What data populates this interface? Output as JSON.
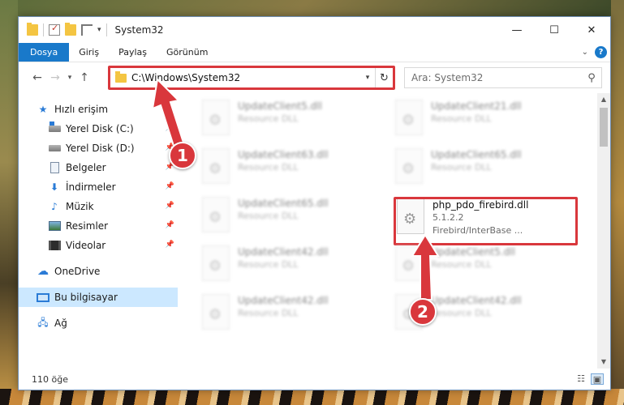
{
  "window": {
    "title": "System32",
    "controls": {
      "minimize": "—",
      "maximize": "☐",
      "close": "✕"
    }
  },
  "ribbon": {
    "tabs": [
      "Dosya",
      "Giriş",
      "Paylaş",
      "Görünüm"
    ],
    "help": "?"
  },
  "navigation": {
    "address": "C:\\Windows\\System32",
    "search_placeholder": "Ara: System32"
  },
  "sidebar": {
    "quick_access": "Hızlı erişim",
    "items": [
      {
        "label": "Yerel Disk (C:)",
        "icon": "disk-c-icon",
        "pinned": true
      },
      {
        "label": "Yerel Disk (D:)",
        "icon": "disk-d-icon",
        "pinned": true
      },
      {
        "label": "Belgeler",
        "icon": "documents-icon",
        "pinned": true
      },
      {
        "label": "İndirmeler",
        "icon": "downloads-icon",
        "pinned": true
      },
      {
        "label": "Müzik",
        "icon": "music-icon",
        "pinned": true
      },
      {
        "label": "Resimler",
        "icon": "pictures-icon",
        "pinned": true
      },
      {
        "label": "Videolar",
        "icon": "videos-icon",
        "pinned": true
      }
    ],
    "onedrive": "OneDrive",
    "this_pc": "Bu bilgisayar",
    "network": "Ağ"
  },
  "files": [
    {
      "name": "UpdateClient5.dll",
      "sub": "Resource DLL"
    },
    {
      "name": "UpdateClient21.dll",
      "sub": "Resource DLL"
    },
    {
      "name": "UpdateClient63.dll",
      "sub": "Resource DLL"
    },
    {
      "name": "UpdateClient65.dll",
      "sub": "Resource DLL"
    },
    {
      "name": "UpdateClient65.dll",
      "sub": "Resource DLL"
    },
    {
      "name": "php_pdo_firebird.dll",
      "version": "5.1.2.2",
      "sub": "Firebird/InterBase ..."
    },
    {
      "name": "UpdateClient42.dll",
      "sub": "Resource DLL"
    },
    {
      "name": "UpdateClient5.dll",
      "sub": "Resource DLL"
    },
    {
      "name": "UpdateClient42.dll",
      "sub": "Resource DLL"
    },
    {
      "name": "UpdateClient42.dll",
      "sub": "Resource DLL"
    }
  ],
  "status": {
    "count": "110 öğe"
  },
  "callouts": {
    "one": "1",
    "two": "2"
  },
  "colors": {
    "accent": "#1979ca",
    "highlight": "#d9373c"
  }
}
